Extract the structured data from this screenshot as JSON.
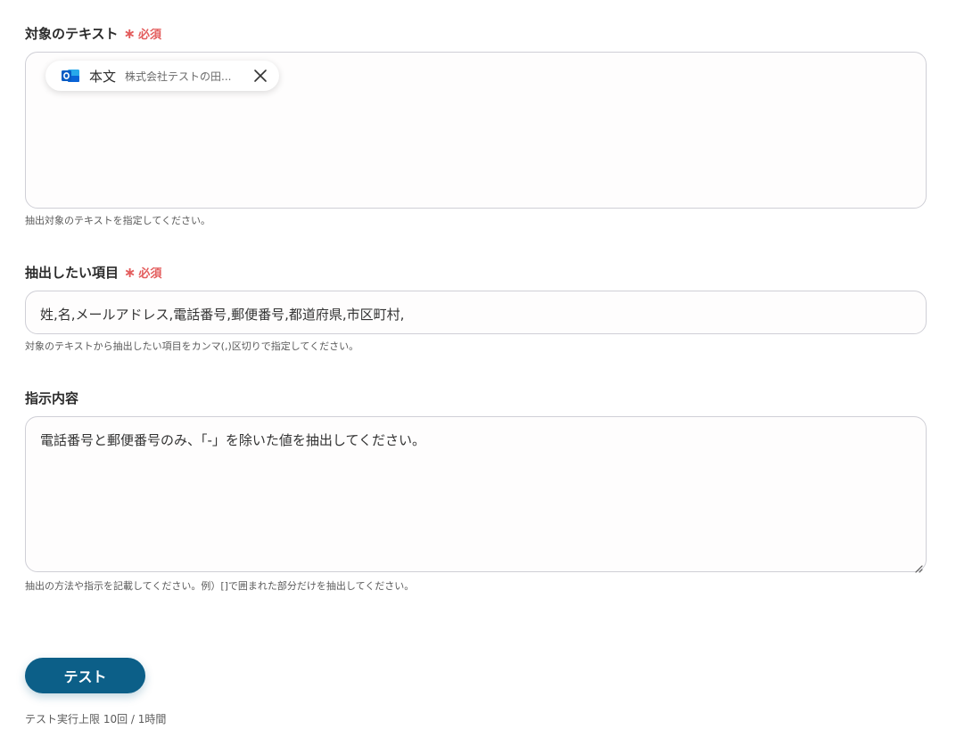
{
  "fields": {
    "target_text": {
      "label": "対象のテキスト",
      "required_label": "必須",
      "chip": {
        "name": "本文",
        "value": "株式会社テストの田..."
      },
      "help": "抽出対象のテキストを指定してください。"
    },
    "extract_items": {
      "label": "抽出したい項目",
      "required_label": "必須",
      "value": "姓,名,メールアドレス,電話番号,郵便番号,都道府県,市区町村,",
      "help": "対象のテキストから抽出したい項目をカンマ(,)区切りで指定してください。"
    },
    "instructions": {
      "label": "指示内容",
      "value": "電話番号と郵便番号のみ、「-」を除いた値を抽出してください。",
      "help": "抽出の方法や指示を記載してください。例）[]で囲まれた部分だけを抽出してください。"
    }
  },
  "test_button": {
    "label": "テスト"
  },
  "limit_text": "テスト実行上限 10回 / 1時間",
  "icons": {
    "chip_app_icon": "outlook-icon",
    "chip_remove_icon": "close-icon",
    "required_marker": "asterisk",
    "resize": "resize-handle-icon"
  },
  "colors": {
    "accent": "#0c5f88",
    "required": "#e35d5d",
    "outlook_blue": "#0a64d6"
  }
}
